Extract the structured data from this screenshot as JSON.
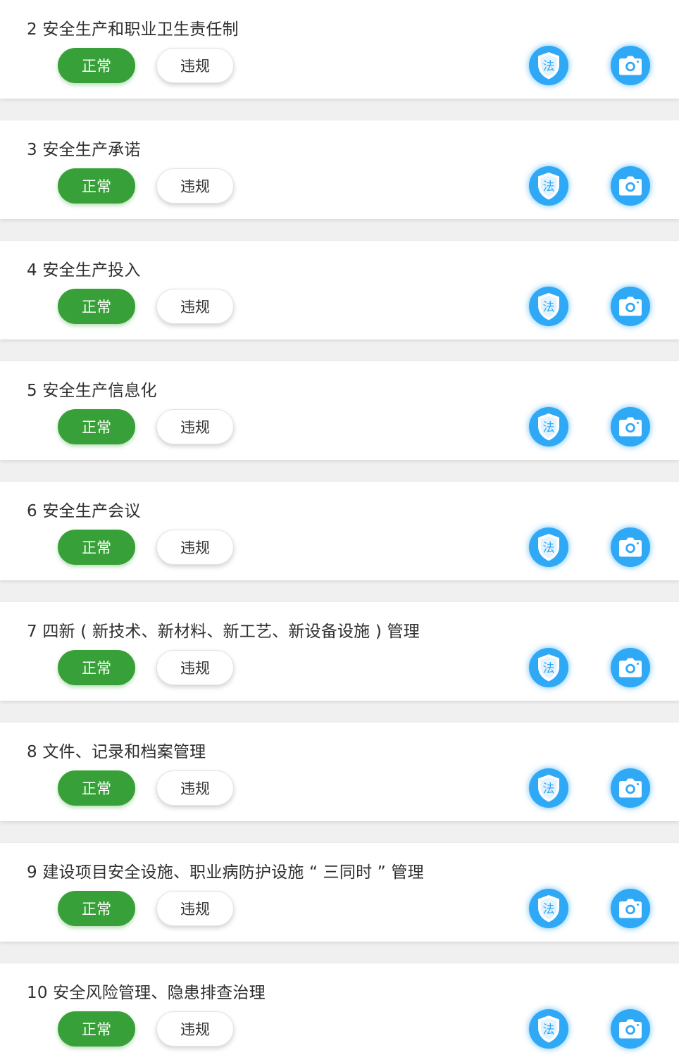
{
  "colors": {
    "page_background": "#f0f0f0",
    "card_background": "#ffffff",
    "normal_button": "#38a038",
    "icon_blue": "#2fa8f5",
    "title_text": "#2f2f2f"
  },
  "law_icon_text": "法",
  "items": [
    {
      "title": "2 安全生产和职业卫生责任制",
      "normal_label": "正常",
      "violation_label": "违规",
      "law_icon": "shield-law-icon",
      "camera_icon": "camera-icon"
    },
    {
      "title": "3 安全生产承诺",
      "normal_label": "正常",
      "violation_label": "违规",
      "law_icon": "shield-law-icon",
      "camera_icon": "camera-icon"
    },
    {
      "title": "4 安全生产投入",
      "normal_label": "正常",
      "violation_label": "违规",
      "law_icon": "shield-law-icon",
      "camera_icon": "camera-icon"
    },
    {
      "title": "5 安全生产信息化",
      "normal_label": "正常",
      "violation_label": "违规",
      "law_icon": "shield-law-icon",
      "camera_icon": "camera-icon"
    },
    {
      "title": "6 安全生产会议",
      "normal_label": "正常",
      "violation_label": "违规",
      "law_icon": "shield-law-icon",
      "camera_icon": "camera-icon"
    },
    {
      "title": "7 四新 ( 新技术、新材料、新工艺、新设备设施 ) 管理",
      "normal_label": "正常",
      "violation_label": "违规",
      "law_icon": "shield-law-icon",
      "camera_icon": "camera-icon"
    },
    {
      "title": "8 文件、记录和档案管理",
      "normal_label": "正常",
      "violation_label": "违规",
      "law_icon": "shield-law-icon",
      "camera_icon": "camera-icon"
    },
    {
      "title": "9 建设项目安全设施、职业病防护设施 “ 三同时 ” 管理",
      "normal_label": "正常",
      "violation_label": "违规",
      "law_icon": "shield-law-icon",
      "camera_icon": "camera-icon"
    },
    {
      "title": "10 安全风险管理、隐患排查治理",
      "normal_label": "正常",
      "violation_label": "违规",
      "law_icon": "shield-law-icon",
      "camera_icon": "camera-icon"
    }
  ]
}
